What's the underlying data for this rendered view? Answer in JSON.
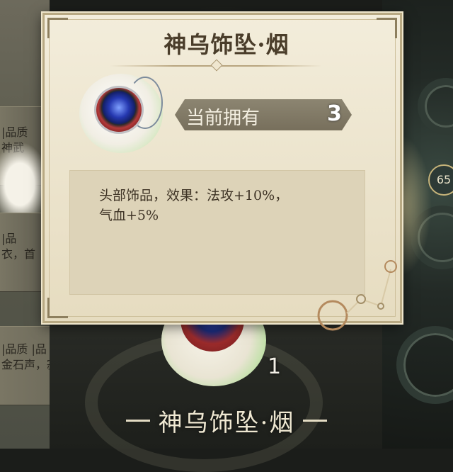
{
  "background": {
    "list_rows": [
      {
        "label_line1": "|品质",
        "label_line2": "神武"
      },
      {
        "label_line1": "|品",
        "label_line2": "衣，首"
      },
      {
        "label_line1": "|品质  |品",
        "label_line2": "金石声，寂入画"
      }
    ],
    "badge_text": "65",
    "bottom_item_count": "1",
    "bottom_item_name": "神乌饰坠·烟"
  },
  "popup": {
    "title": "神乌饰坠·烟",
    "owned_label": "当前拥有",
    "owned_count": "3",
    "description_line1": "头部饰品，效果：法攻+10%，",
    "description_line2": "气血+5%"
  },
  "colors": {
    "parchment": "#efe7d2",
    "title_text": "#4a3d2a",
    "owned_bar": "#7f7864",
    "description_box": "#ddd3b8"
  }
}
